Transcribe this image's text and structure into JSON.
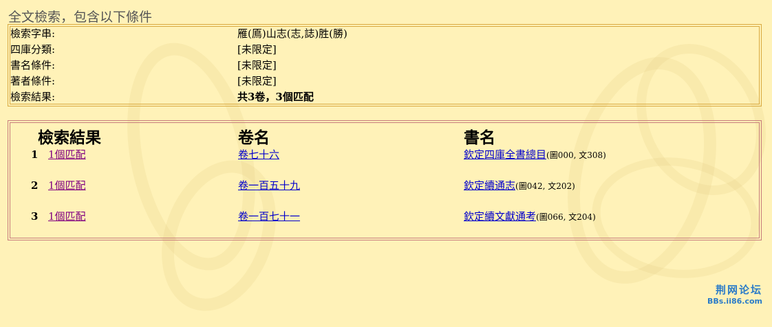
{
  "page": {
    "title": "全文檢索，包含以下條件"
  },
  "conditions": [
    {
      "label": "檢索字串:",
      "value": "雁(鳫)山志(志,誌)胜(勝)",
      "bold": false
    },
    {
      "label": "四庫分類:",
      "value": "[未限定]",
      "bold": false
    },
    {
      "label": "書名條件:",
      "value": "[未限定]",
      "bold": false
    },
    {
      "label": "著者條件:",
      "value": "[未限定]",
      "bold": false
    },
    {
      "label": "檢索結果:",
      "value": "共3卷，3個匹配",
      "bold": true
    }
  ],
  "results": {
    "headers": {
      "result": "檢索結果",
      "volume": "卷名",
      "book": "書名"
    },
    "rows": [
      {
        "num": "1",
        "matches": "1個匹配",
        "volume": "卷七十六",
        "book": "欽定四庫全書總目",
        "meta": "(圖000, 文308)"
      },
      {
        "num": "2",
        "matches": "1個匹配",
        "volume": "卷一百五十九",
        "book": "欽定續通志",
        "meta": "(圖042, 文202)"
      },
      {
        "num": "3",
        "matches": "1個匹配",
        "volume": "卷一百七十一",
        "book": "欽定續文獻通考",
        "meta": "(圖066, 文204)"
      }
    ]
  },
  "watermark": {
    "forum_name": "荆网论坛",
    "forum_url": "BBs.ii86.com"
  },
  "colors": {
    "background": "#FFF2B8",
    "conditions_border": "#D9A940",
    "results_border": "#C77C7C",
    "link": "#0000CC",
    "visited_link": "#800080",
    "logo": "#2A7BC8"
  }
}
